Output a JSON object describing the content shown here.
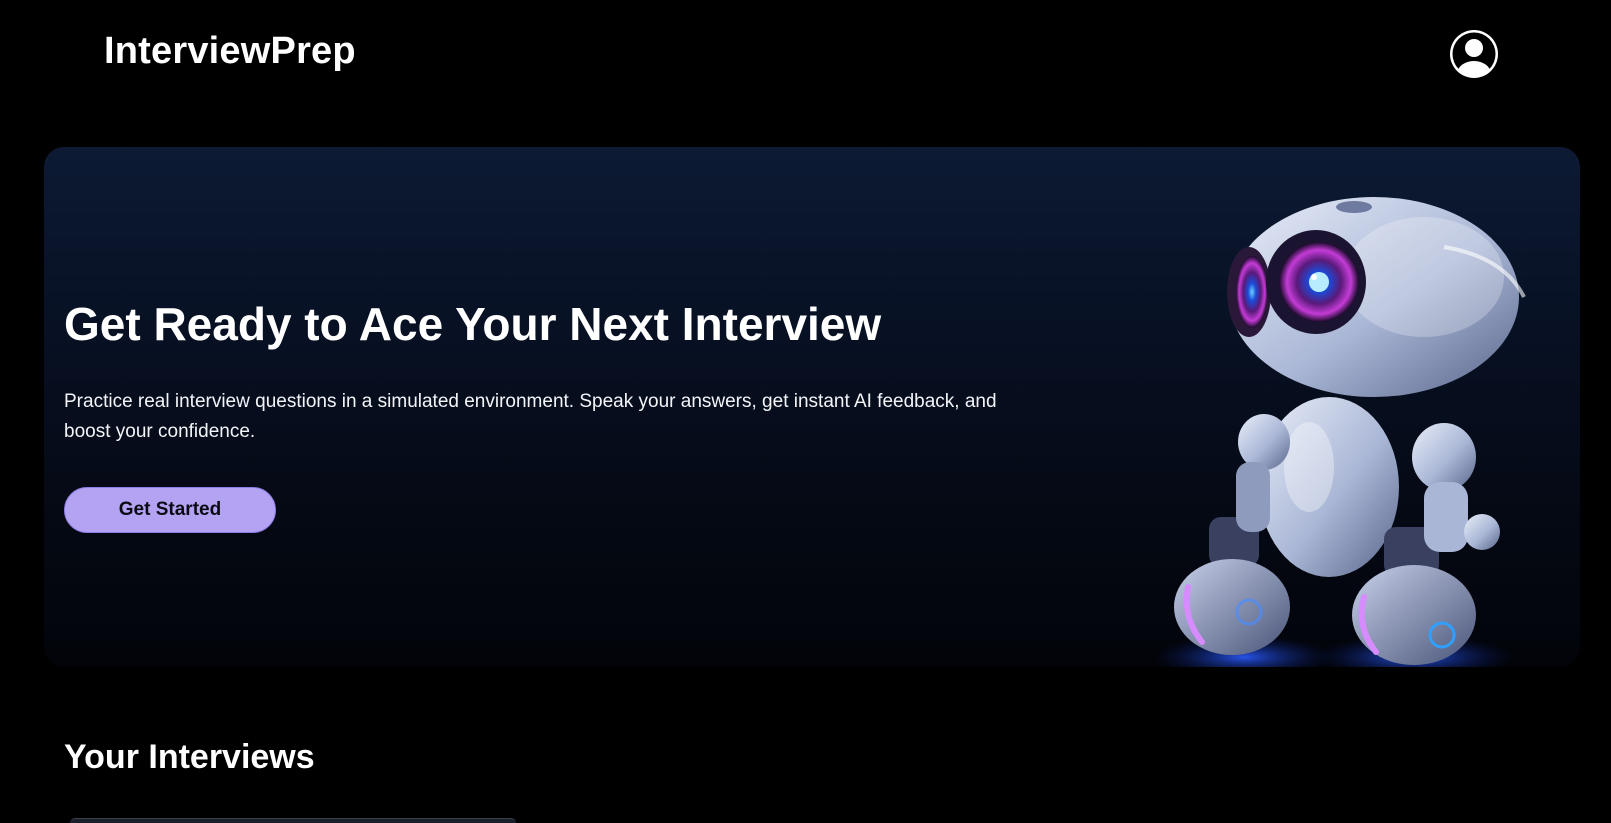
{
  "header": {
    "brand": "InterviewPrep",
    "profile_icon": "user-circle-icon"
  },
  "hero": {
    "title": "Get Ready to Ace Your Next Interview",
    "subtitle": "Practice real interview questions in a simulated environment. Speak your answers, get instant AI feedback, and boost your confidence.",
    "cta_label": "Get Started",
    "image": "robot-illustration",
    "accent_color": "#b4a3f3"
  },
  "interviews": {
    "heading": "Your Interviews"
  }
}
